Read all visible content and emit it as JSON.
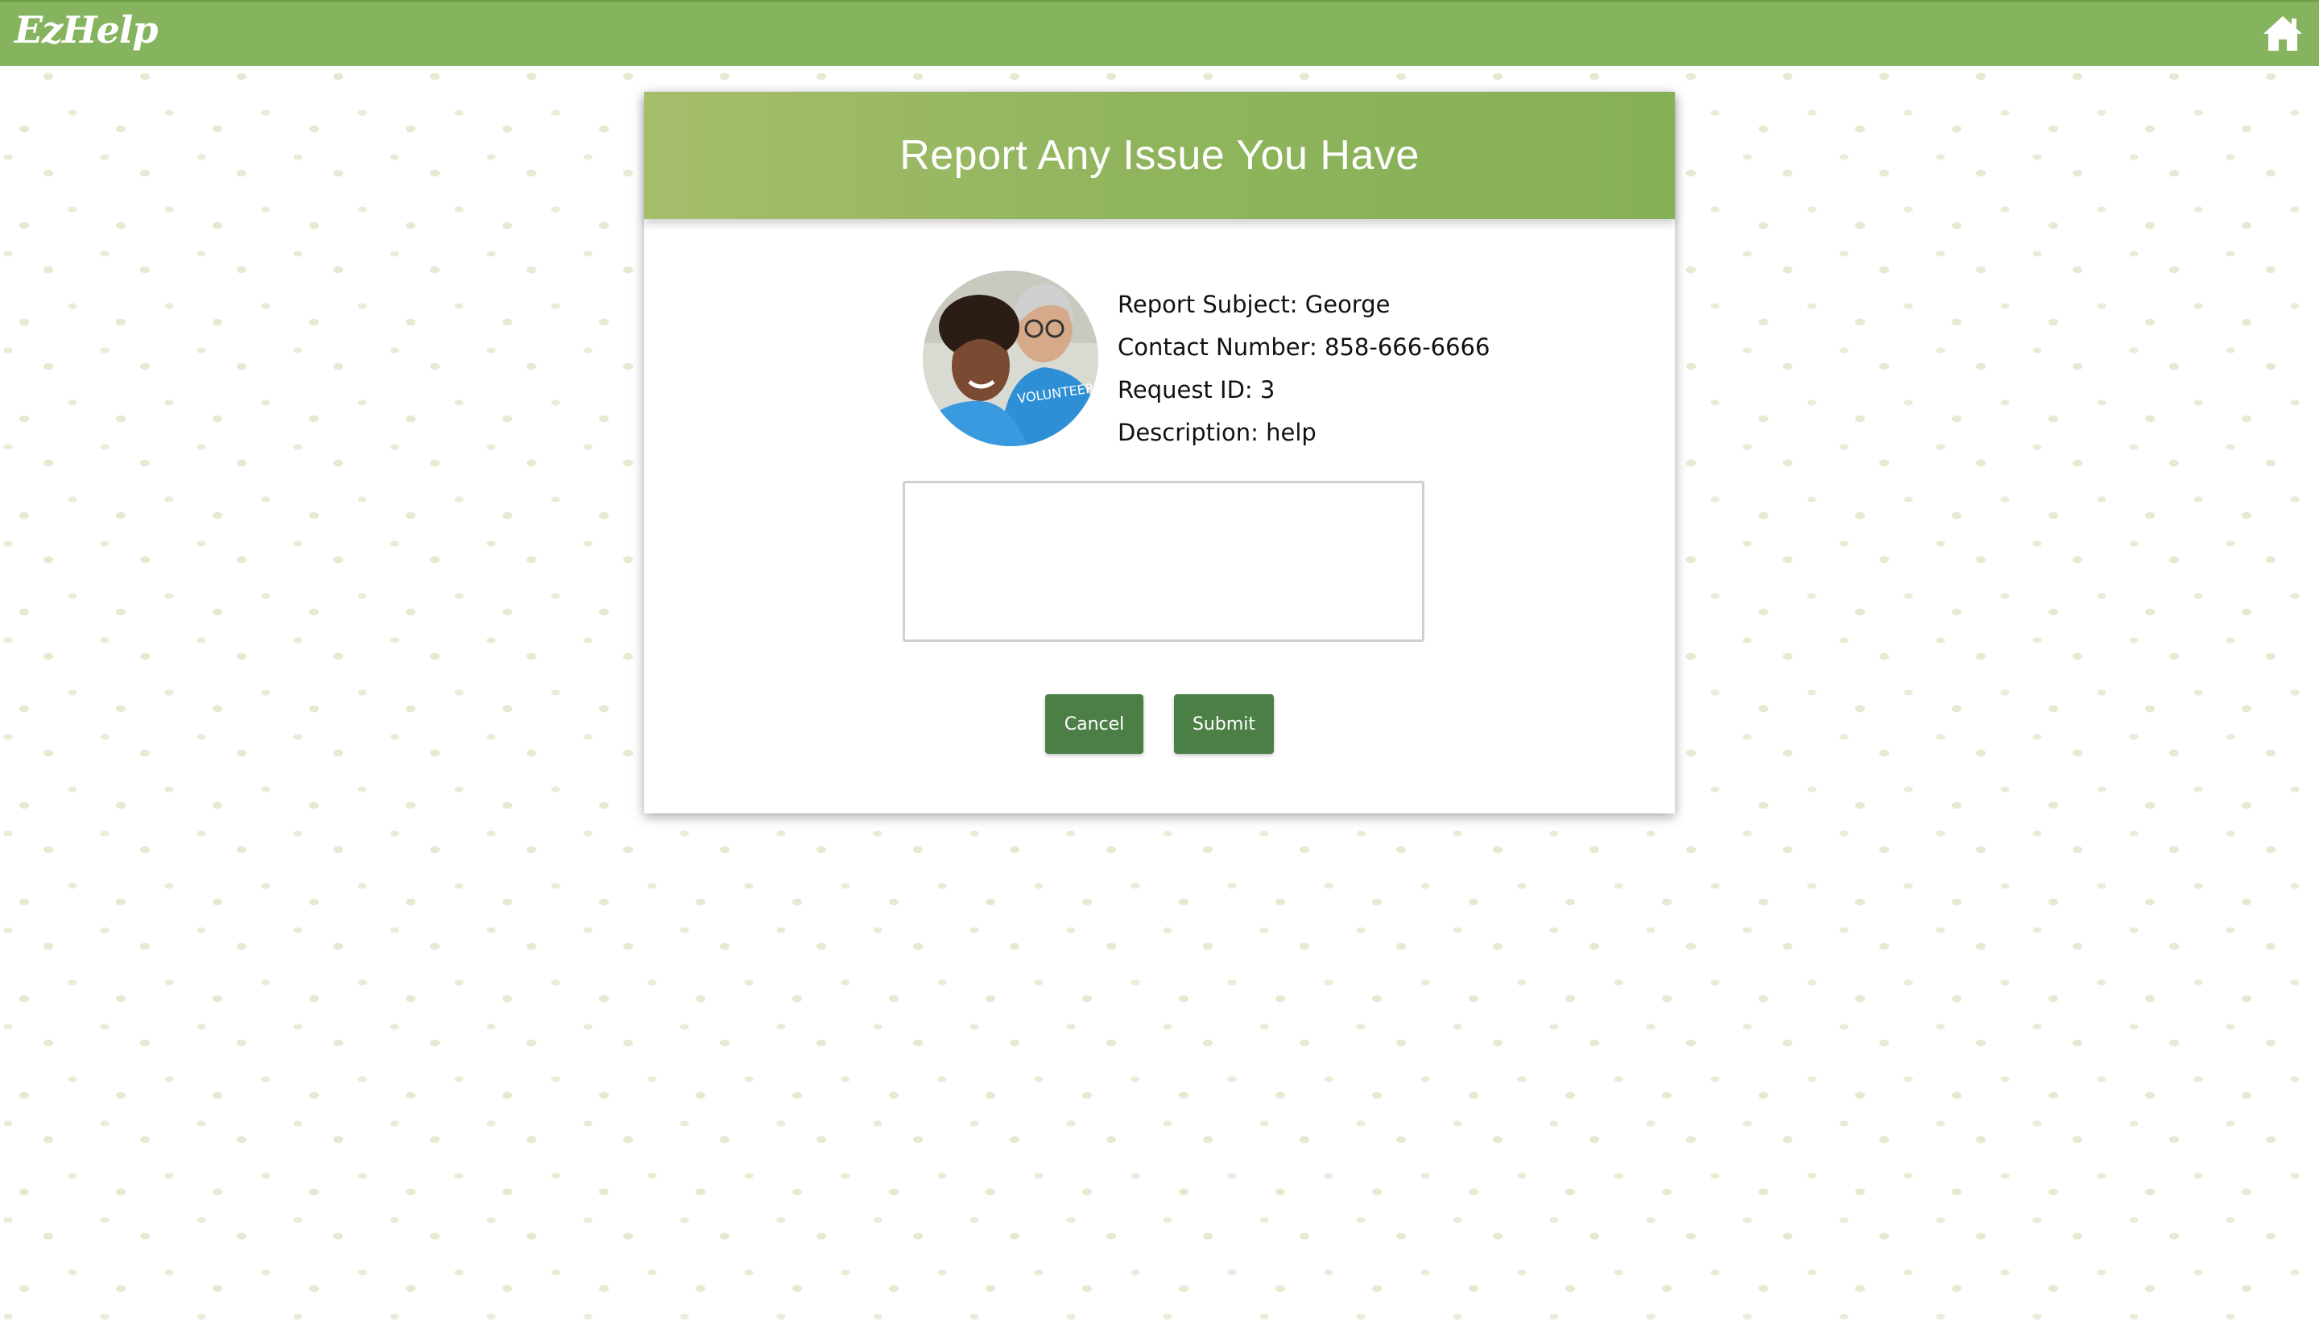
{
  "app": {
    "logo_text": "EzHelp",
    "home_icon": "home-icon"
  },
  "report": {
    "title": "Report Any Issue You Have",
    "subject": "Report Subject: George",
    "contact": "Contact Number: 858-666-6666",
    "request_id": "Request ID: 3",
    "description": "Description: help",
    "textarea_value": "",
    "cancel_label": "Cancel",
    "submit_label": "Submit"
  },
  "colors": {
    "topbar": "#86b45e",
    "header_gradient_start": "#a6bd6c",
    "header_gradient_end": "#86b058",
    "button": "#4c7f46"
  }
}
